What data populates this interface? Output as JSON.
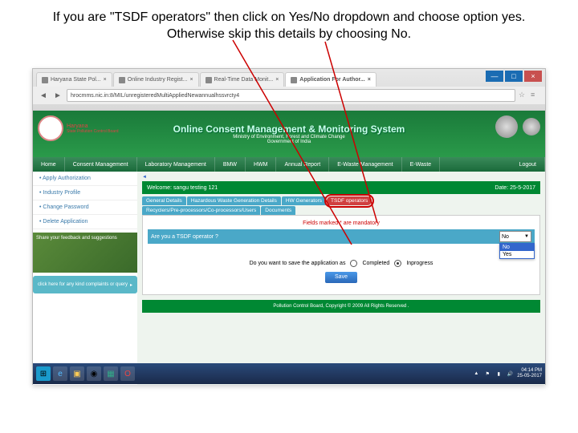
{
  "instruction_text": "If you are \"TSDF operators\" then click on Yes/No dropdown and choose option yes. Otherwise skip this details by choosing No.",
  "window": {
    "minimize": "—",
    "maximize": "□",
    "close": "×"
  },
  "browser_tabs": [
    {
      "label": "Haryana State Pol..."
    },
    {
      "label": "Online Industry Regist..."
    },
    {
      "label": "Real-Time Data Monit..."
    },
    {
      "label": "Application For Author..."
    }
  ],
  "url": "hrocmms.nic.in:8/MIL/unregisteredMultiAppliedNewannualhssvrcty4",
  "banner": {
    "state": "Haryana",
    "board": "State Pollution Control Board",
    "title": "Online Consent Management & Monitoring System",
    "subtitle1": "Ministry of Environment, Forest and Climate Change",
    "subtitle2": "Government of India"
  },
  "nav_items": [
    "Home",
    "Consent Management",
    "Laboratory Management",
    "BMW",
    "HWM",
    "Annual Report",
    "E-Waste Management",
    "E-Waste",
    "Logout"
  ],
  "side_nav": [
    "Apply Authorization",
    "Industry Profile",
    "Change Password",
    "Delete Application"
  ],
  "feedback": "Share your feedback and suggestions",
  "complaint": "click here for any kind complaints or query",
  "welcome": {
    "left": "Welcome: sangu testing 121",
    "right": "Date: 25-5-2017"
  },
  "form_tabs": [
    "General Details",
    "Hazardous Waste Generation Details",
    "HW Generators",
    "TSDF operators",
    "Recyclers/Pre-processors/Co-processors/Users",
    "Documents"
  ],
  "mandatory": "Fields marked * are mandatory",
  "question1": "Are you a TSDF operator ?",
  "dropdown": {
    "selected": "No",
    "options": [
      "No",
      "Yes"
    ]
  },
  "question2": "Do you want to save the application as",
  "radio_completed": "Completed",
  "radio_inprogress": "Inprogress",
  "save": "Save",
  "footer": "Pollution Control Board, Copyright © 2009 All Rights Reserved .",
  "clock": {
    "time": "04:14 PM",
    "date": "25-05-2017"
  }
}
